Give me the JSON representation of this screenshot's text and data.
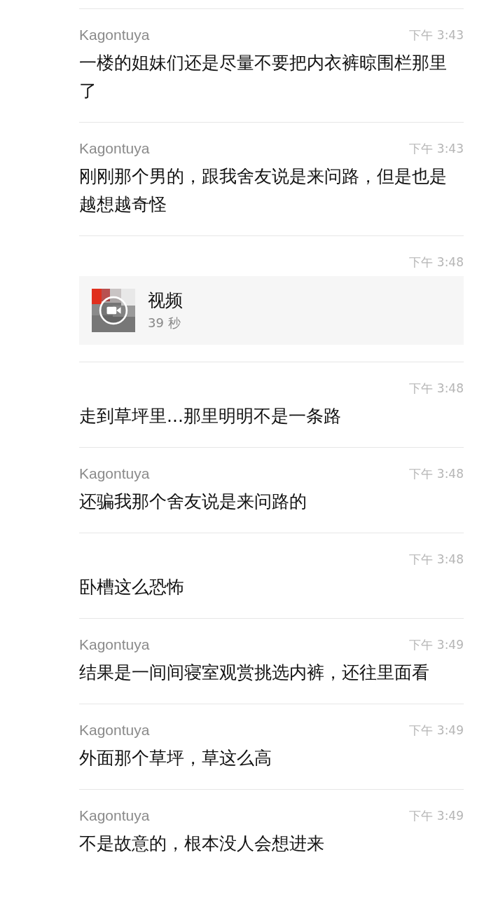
{
  "messages": [
    {
      "kind": "text",
      "sender": "Kagontuya",
      "time": "下午 3:43",
      "text": "一楼的姐妹们还是尽量不要把内衣裤晾围栏那里了"
    },
    {
      "kind": "text",
      "sender": "Kagontuya",
      "time": "下午 3:43",
      "text": "刚刚那个男的，跟我舍友说是来问路，但是也是越想越奇怪"
    },
    {
      "kind": "video",
      "time": "下午 3:48",
      "title": "视频",
      "duration": "39 秒"
    },
    {
      "kind": "text",
      "time": "下午 3:48",
      "text": "走到草坪里...那里明明不是一条路"
    },
    {
      "kind": "text",
      "sender": "Kagontuya",
      "time": "下午 3:48",
      "text": "还骗我那个舍友说是来问路的"
    },
    {
      "kind": "text",
      "time": "下午 3:48",
      "text": "卧槽这么恐怖"
    },
    {
      "kind": "text",
      "sender": "Kagontuya",
      "time": "下午 3:49",
      "text": "结果是一间间寝室观赏挑选内裤，还往里面看"
    },
    {
      "kind": "text",
      "sender": "Kagontuya",
      "time": "下午 3:49",
      "text": "外面那个草坪，草这么高"
    },
    {
      "kind": "text",
      "sender": "Kagontuya",
      "time": "下午 3:49",
      "text": "不是故意的，根本没人会想进来"
    }
  ]
}
